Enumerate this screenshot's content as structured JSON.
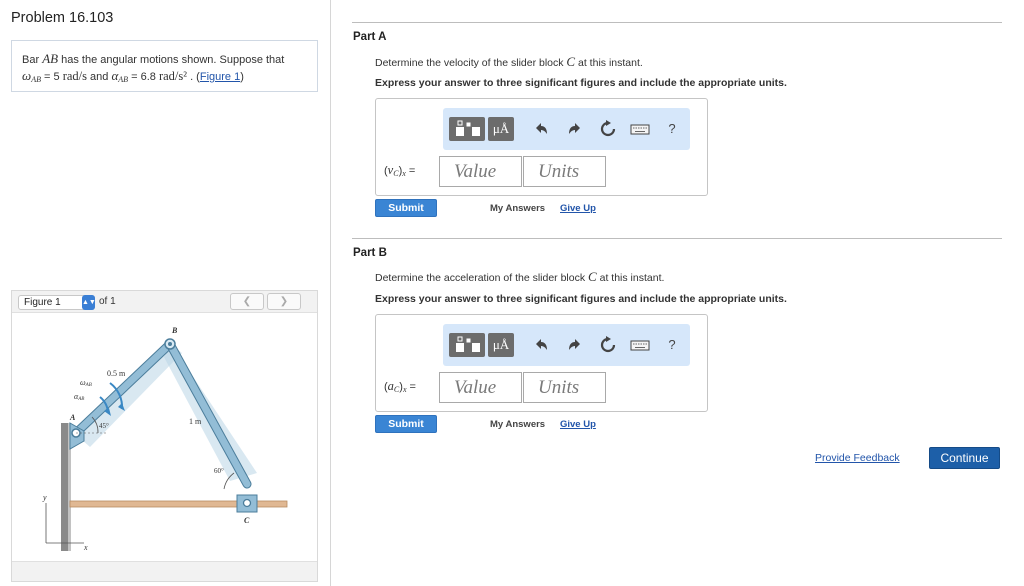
{
  "problem": {
    "title": "Problem 16.103",
    "statement": {
      "prefix": "Bar ",
      "bar_name": "AB",
      "mid1": " has the angular motions shown. Suppose that",
      "omega": "ω",
      "omega_sub": "AB",
      "omega_value": " = 5 ",
      "omega_unit": "rad/s",
      "and": " and ",
      "alpha": "α",
      "alpha_sub": "AB",
      "alpha_value": " = 6.8 ",
      "alpha_unit": "rad/s²",
      "figure_link_pre": " . (",
      "figure_link": "Figure 1",
      "figure_link_post": ")"
    }
  },
  "figure": {
    "selector": "Figure 1",
    "of_label": "of 1",
    "prev_icon": "chevron-left-icon",
    "next_icon": "chevron-right-icon",
    "labels": {
      "B": "B",
      "A": "A",
      "C": "C",
      "len_ab": "0.5 m",
      "len_bc": "1 m",
      "angle_a": "45°",
      "angle_c": "60°",
      "omega": "ω",
      "alpha": "α",
      "sub": "AB",
      "x": "x",
      "y": "y"
    },
    "colors": {
      "bar": "#93bdd6",
      "bar_edge": "#4b7d9b",
      "rail": "#e0b893",
      "wall": "#8a8a8a",
      "arrow": "#3a88c4",
      "shadow": "#b9d5e6"
    }
  },
  "part_a": {
    "title": "Part A",
    "question_pre": "Determine the velocity of the slider block ",
    "question_var": "C",
    "question_post": " at this instant.",
    "instruction": "Express your answer to three significant figures and include the appropriate units.",
    "answer_label_open": "(",
    "answer_label_var": "v",
    "answer_label_sub": "C",
    "answer_label_close": ")",
    "answer_label_xsub": "x",
    "answer_label_eq": " =",
    "value_placeholder": "Value",
    "units_placeholder": "Units",
    "submit": "Submit",
    "my_answers": "My Answers",
    "give_up": "Give Up"
  },
  "part_b": {
    "title": "Part B",
    "question_pre": "Determine the acceleration of the slider block ",
    "question_var": "C",
    "question_post": " at this instant.",
    "instruction": "Express your answer to three significant figures and include the appropriate units.",
    "answer_label_open": "(",
    "answer_label_var": "a",
    "answer_label_sub": "C",
    "answer_label_close": ")",
    "answer_label_xsub": "x",
    "answer_label_eq": " =",
    "value_placeholder": "Value",
    "units_placeholder": "Units",
    "submit": "Submit",
    "my_answers": "My Answers",
    "give_up": "Give Up"
  },
  "toolbar": {
    "units_symbol": "μÅ",
    "help": "?",
    "icons": [
      "templates-icon",
      "units-icon",
      "undo-icon",
      "redo-icon",
      "reset-icon",
      "keyboard-icon",
      "help-icon"
    ]
  },
  "footer": {
    "feedback": "Provide Feedback",
    "continue": "Continue"
  }
}
